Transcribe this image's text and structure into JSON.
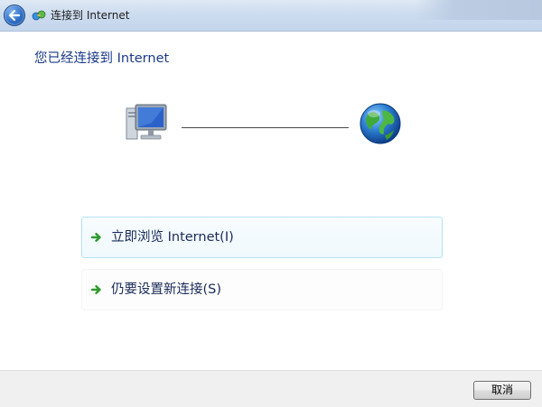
{
  "window": {
    "title": "连接到 Internet"
  },
  "main": {
    "heading": "您已经连接到 Internet"
  },
  "options": [
    {
      "label": "立即浏览 Internet(I)"
    },
    {
      "label": "仍要设置新连接(S)"
    }
  ],
  "footer": {
    "cancel_label": "取消"
  },
  "colors": {
    "heading": "#1a3a8a",
    "arrow": "#2e9a2e",
    "option_highlight_border": "#b6e2f2"
  },
  "icons": {
    "back": "back-arrow-icon",
    "title": "network-connection-icon",
    "computer": "computer-icon",
    "internet": "globe-icon",
    "option_arrow": "green-arrow-icon"
  }
}
